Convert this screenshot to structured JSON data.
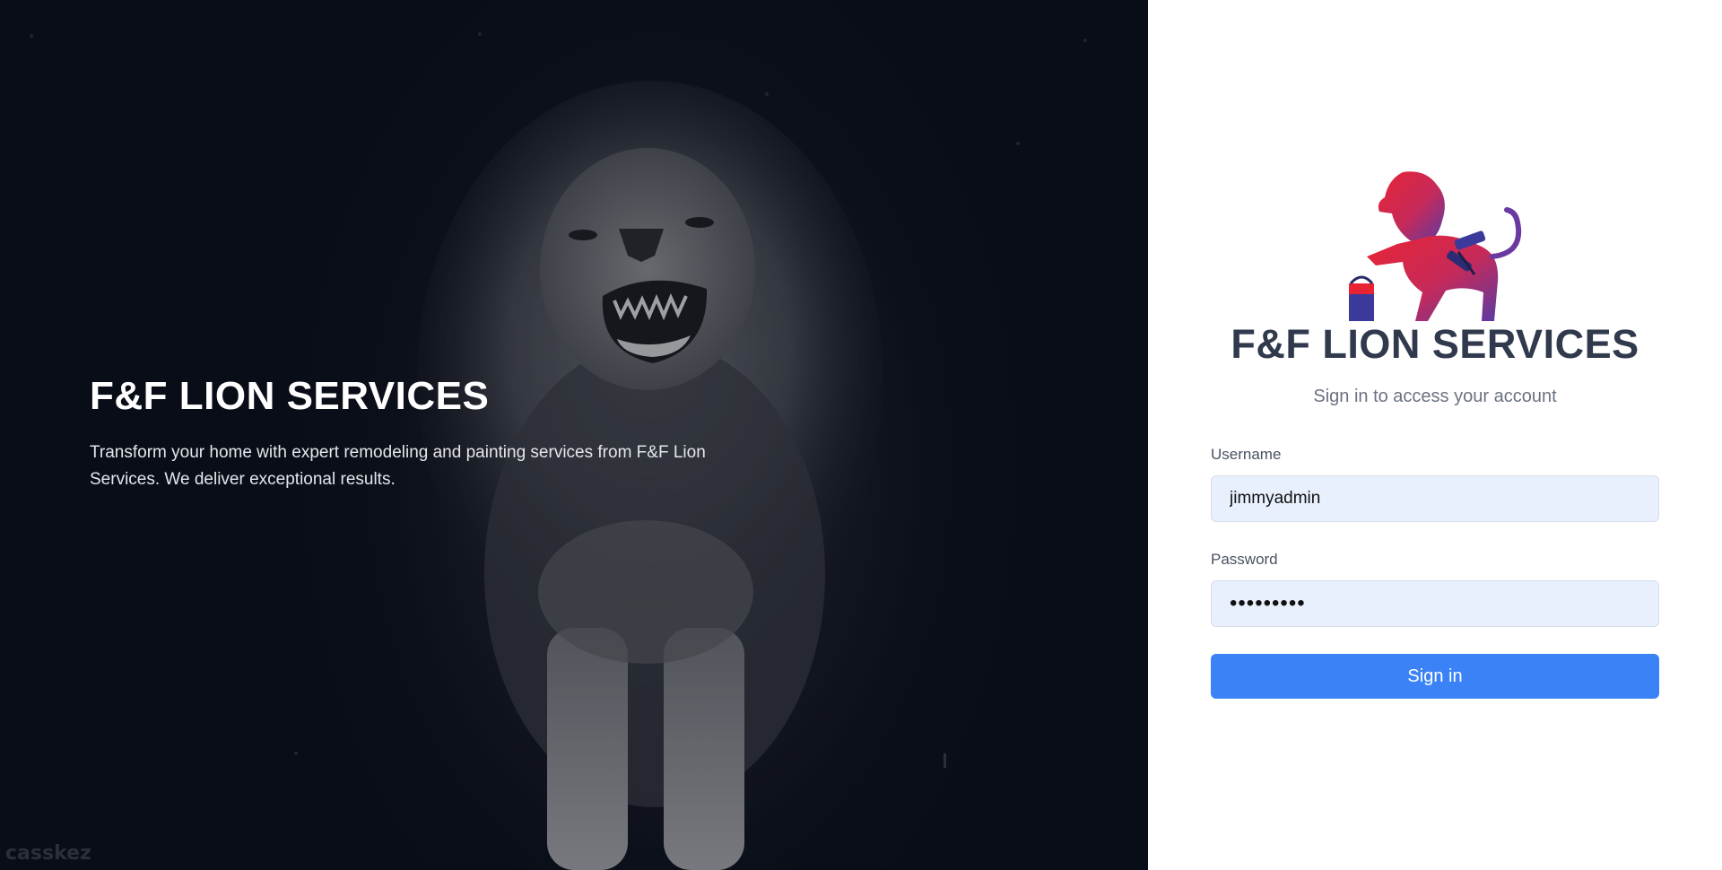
{
  "hero": {
    "title": "F&F LION SERVICES",
    "description": "Transform your home with expert remodeling and painting services from F&F Lion Services. We deliver exceptional results.",
    "watermark": "casskez"
  },
  "login": {
    "logo_icon": "lion-painter-logo-icon",
    "brand_title": "F&F LION SERVICES",
    "subtitle": "Sign in to access your account",
    "username_label": "Username",
    "username_value": "jimmyadmin",
    "password_label": "Password",
    "password_value": "jimmypass",
    "signin_label": "Sign in"
  },
  "colors": {
    "primary": "#3b82f6",
    "brand_text": "#313a4c",
    "hero_bg": "#0b0f18",
    "logo_red": "#e0243a",
    "logo_purple": "#5b3aa0"
  }
}
